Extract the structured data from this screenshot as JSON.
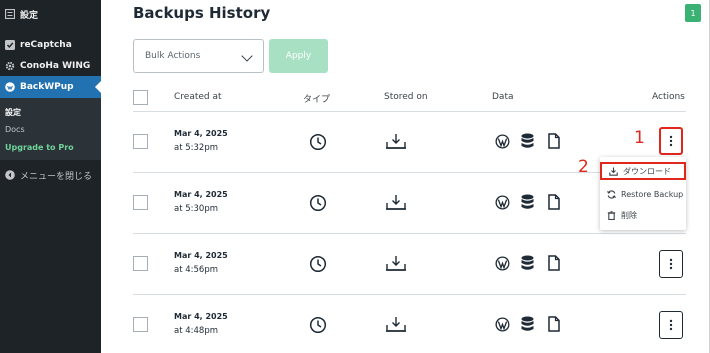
{
  "sidebar": {
    "items": [
      {
        "label": "設定",
        "icon": "settings-square-icon"
      },
      {
        "label": "reCaptcha",
        "icon": "checkbox-icon"
      },
      {
        "label": "ConoHa WING",
        "icon": "gear-icon"
      },
      {
        "label": "BackWPup",
        "icon": "backwpup-logo-icon"
      }
    ],
    "submenu": [
      {
        "label": "設定"
      },
      {
        "label": "Docs"
      },
      {
        "label": "Upgrade to Pro"
      }
    ],
    "collapse_label": "メニューを閉じる"
  },
  "page": {
    "title": "Backups History",
    "badge": "1"
  },
  "toolbar": {
    "bulk_actions": "Bulk Actions",
    "apply": "Apply"
  },
  "table": {
    "headers": {
      "created_at": "Created at",
      "type": "タイプ",
      "stored_on": "Stored on",
      "data": "Data",
      "actions": "Actions"
    },
    "rows": [
      {
        "date": "Mar 4, 2025",
        "time": "at 5:32pm"
      },
      {
        "date": "Mar 4, 2025",
        "time": "at 5:30pm"
      },
      {
        "date": "Mar 4, 2025",
        "time": "at 4:56pm"
      },
      {
        "date": "Mar 4, 2025",
        "time": "at 4:48pm"
      }
    ]
  },
  "actions_menu": {
    "download": "ダウンロード",
    "restore": "Restore Backup",
    "delete": "削除"
  },
  "annotations": {
    "step1": "1",
    "step2": "2"
  },
  "colors": {
    "sidebar_bg": "#1d2327",
    "sidebar_active": "#2271b1",
    "badge_green": "#3bb273",
    "apply_green": "#a8e0c4",
    "highlight_red": "#e1261c"
  }
}
